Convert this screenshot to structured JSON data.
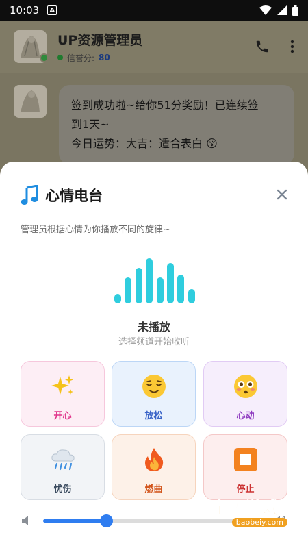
{
  "status_bar": {
    "time": "10:03"
  },
  "chat_header": {
    "name": "UP资源管理员",
    "score_label": "信誉分:",
    "score_value": "80"
  },
  "message": {
    "line1": "签到成功啦~给你51分奖励！已连续签",
    "line2": "到1天~",
    "line3": "今日运势：大吉：适合表白 😚"
  },
  "sheet": {
    "title": "心情电台",
    "description": "管理员根据心情为你播放不同的旋律~",
    "state_title": "未播放",
    "state_subtitle": "选择频道开始收听",
    "equalizer_levels": [
      0.2,
      0.55,
      0.75,
      0.95,
      0.55,
      0.85,
      0.6,
      0.3
    ],
    "tiles": [
      {
        "label": "开心",
        "icon": "sparkles-icon",
        "color": "#e0338a",
        "bg": "#fdeef5",
        "border": "#f6c7dc"
      },
      {
        "label": "放松",
        "icon": "relieved-face-icon",
        "color": "#3a64c8",
        "bg": "#e9f2fd",
        "border": "#bcd6f6"
      },
      {
        "label": "心动",
        "icon": "flushed-face-icon",
        "color": "#8e3ac0",
        "bg": "#f6eefc",
        "border": "#e1cbf4"
      },
      {
        "label": "忧伤",
        "icon": "rain-cloud-icon",
        "color": "#3a4a5e",
        "bg": "#f2f4f7",
        "border": "#d8dde4"
      },
      {
        "label": "燃曲",
        "icon": "fire-icon",
        "color": "#d2541a",
        "bg": "#fdf1e8",
        "border": "#f6d4bd"
      },
      {
        "label": "停止",
        "icon": "stop-button-icon",
        "color": "#cc3333",
        "bg": "#fdeeee",
        "border": "#f4c8c8"
      }
    ],
    "volume": 0.28
  },
  "watermark": {
    "text": "宝贝游戏网",
    "url": "baobeiy.com"
  }
}
